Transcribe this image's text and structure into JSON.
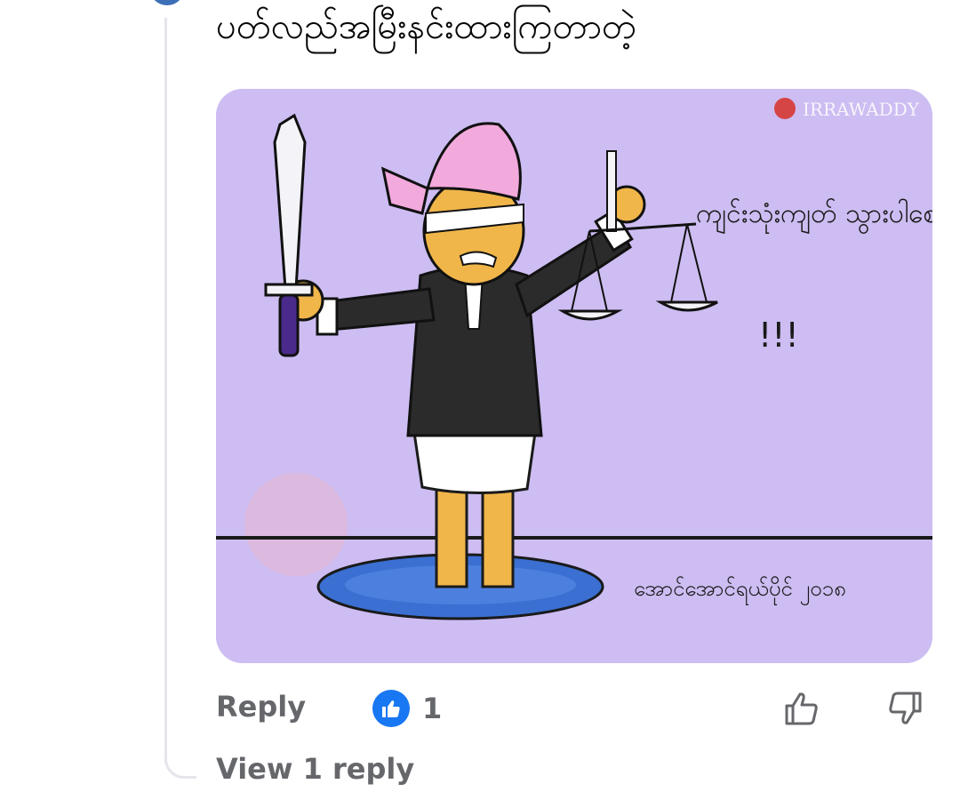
{
  "comment": {
    "text": "ပတ်လည်အမြီးနင်းထားကြတာတဲ့",
    "image": {
      "type": "cartoon",
      "caption_text": "ကျင်းသုံးကျတ် သွားပါစေ......",
      "signature": "အောင်အောင်ရယ်ပိုင် ၂၀၁၈",
      "watermark": "IRRAWADDY"
    }
  },
  "actions": {
    "reply_label": "Reply",
    "reaction_icon": "like-icon",
    "reaction_count": "1",
    "upvote_icon": "thumbs-up-outline-icon",
    "downvote_icon": "thumbs-down-outline-icon"
  },
  "replies": {
    "view_label": "View 1 reply"
  },
  "colors": {
    "like_blue": "#1877f2",
    "secondary_text": "#65676b",
    "thread_line": "#e4e6eb",
    "image_background": "#cdbdf2"
  }
}
